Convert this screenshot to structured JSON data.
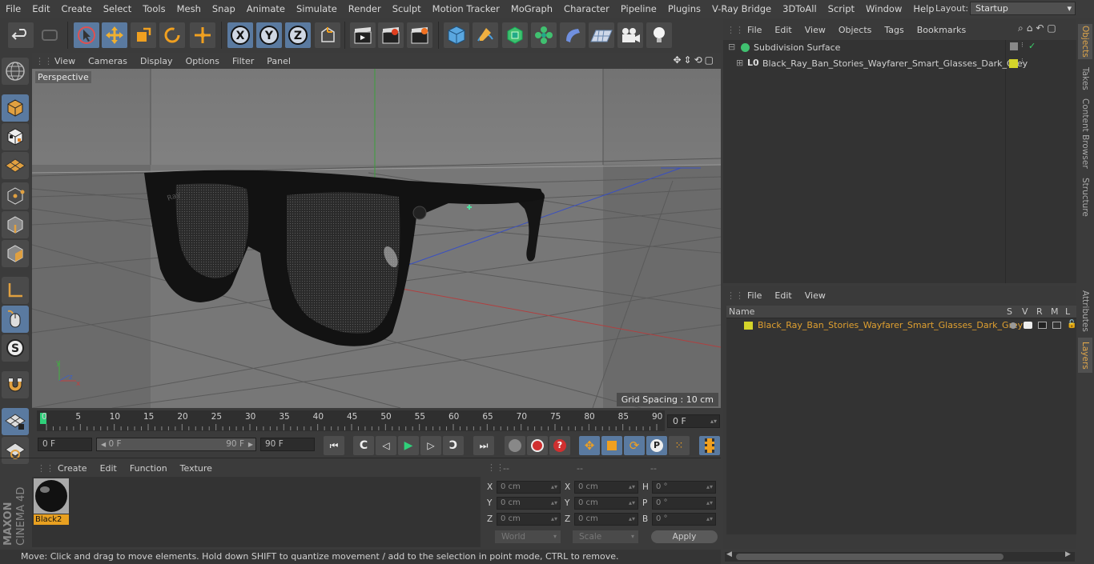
{
  "menubar": {
    "items": [
      "File",
      "Edit",
      "Create",
      "Select",
      "Tools",
      "Mesh",
      "Snap",
      "Animate",
      "Simulate",
      "Render",
      "Sculpt",
      "Motion Tracker",
      "MoGraph",
      "Character",
      "Pipeline",
      "Plugins",
      "V-Ray Bridge",
      "3DToAll",
      "Script",
      "Window",
      "Help"
    ],
    "layout_label": "Layout:",
    "layout_value": "Startup"
  },
  "viewport": {
    "menu": [
      "View",
      "Cameras",
      "Display",
      "Options",
      "Filter",
      "Panel"
    ],
    "label": "Perspective",
    "grid_spacing": "Grid Spacing : 10 cm"
  },
  "timeline": {
    "ticks": [
      "0",
      "5",
      "10",
      "15",
      "20",
      "25",
      "30",
      "35",
      "40",
      "45",
      "50",
      "55",
      "60",
      "65",
      "70",
      "75",
      "80",
      "85",
      "90"
    ],
    "current_frame": "0 F",
    "start_field": "0 F",
    "range_start": "0 F",
    "range_end": "90 F",
    "end_field": "90 F"
  },
  "material_panel": {
    "menu": [
      "Create",
      "Edit",
      "Function",
      "Texture"
    ],
    "material_name": "Black2"
  },
  "coordinates": {
    "headers": [
      "--",
      "--",
      "--"
    ],
    "rows": [
      {
        "l1": "X",
        "v1": "0 cm",
        "l2": "X",
        "v2": "0 cm",
        "l3": "H",
        "v3": "0 °"
      },
      {
        "l1": "Y",
        "v1": "0 cm",
        "l2": "Y",
        "v2": "0 cm",
        "l3": "P",
        "v3": "0 °"
      },
      {
        "l1": "Z",
        "v1": "0 cm",
        "l2": "Z",
        "v2": "0 cm",
        "l3": "B",
        "v3": "0 °"
      }
    ],
    "world": "World",
    "scale": "Scale",
    "apply": "Apply"
  },
  "objects_panel": {
    "menu": [
      "File",
      "Edit",
      "View",
      "Objects",
      "Tags",
      "Bookmarks"
    ],
    "items": [
      "Subdivision Surface",
      "Black_Ray_Ban_Stories_Wayfarer_Smart_Glasses_Dark_Grey"
    ]
  },
  "layers_panel": {
    "menu": [
      "File",
      "Edit",
      "View"
    ],
    "header_name": "Name",
    "header_cols": [
      "S",
      "V",
      "R",
      "M",
      "L"
    ],
    "layer": "Black_Ray_Ban_Stories_Wayfarer_Smart_Glasses_Dark_Grey"
  },
  "side_tabs": {
    "objects": "Objects",
    "takes": "Takes",
    "content_browser": "Content Browser",
    "structure": "Structure",
    "attributes": "Attributes",
    "layers": "Layers"
  },
  "brand": {
    "maxon": "MAXON",
    "cinema": "CINEMA 4D"
  },
  "status": "Move: Click and drag to move elements. Hold down SHIFT to quantize movement / add to the selection in point mode, CTRL to remove.",
  "colors": {
    "accent": "#5a7aa0",
    "layer_yellow": "#d4d42a",
    "layer_text": "#e0a030"
  }
}
